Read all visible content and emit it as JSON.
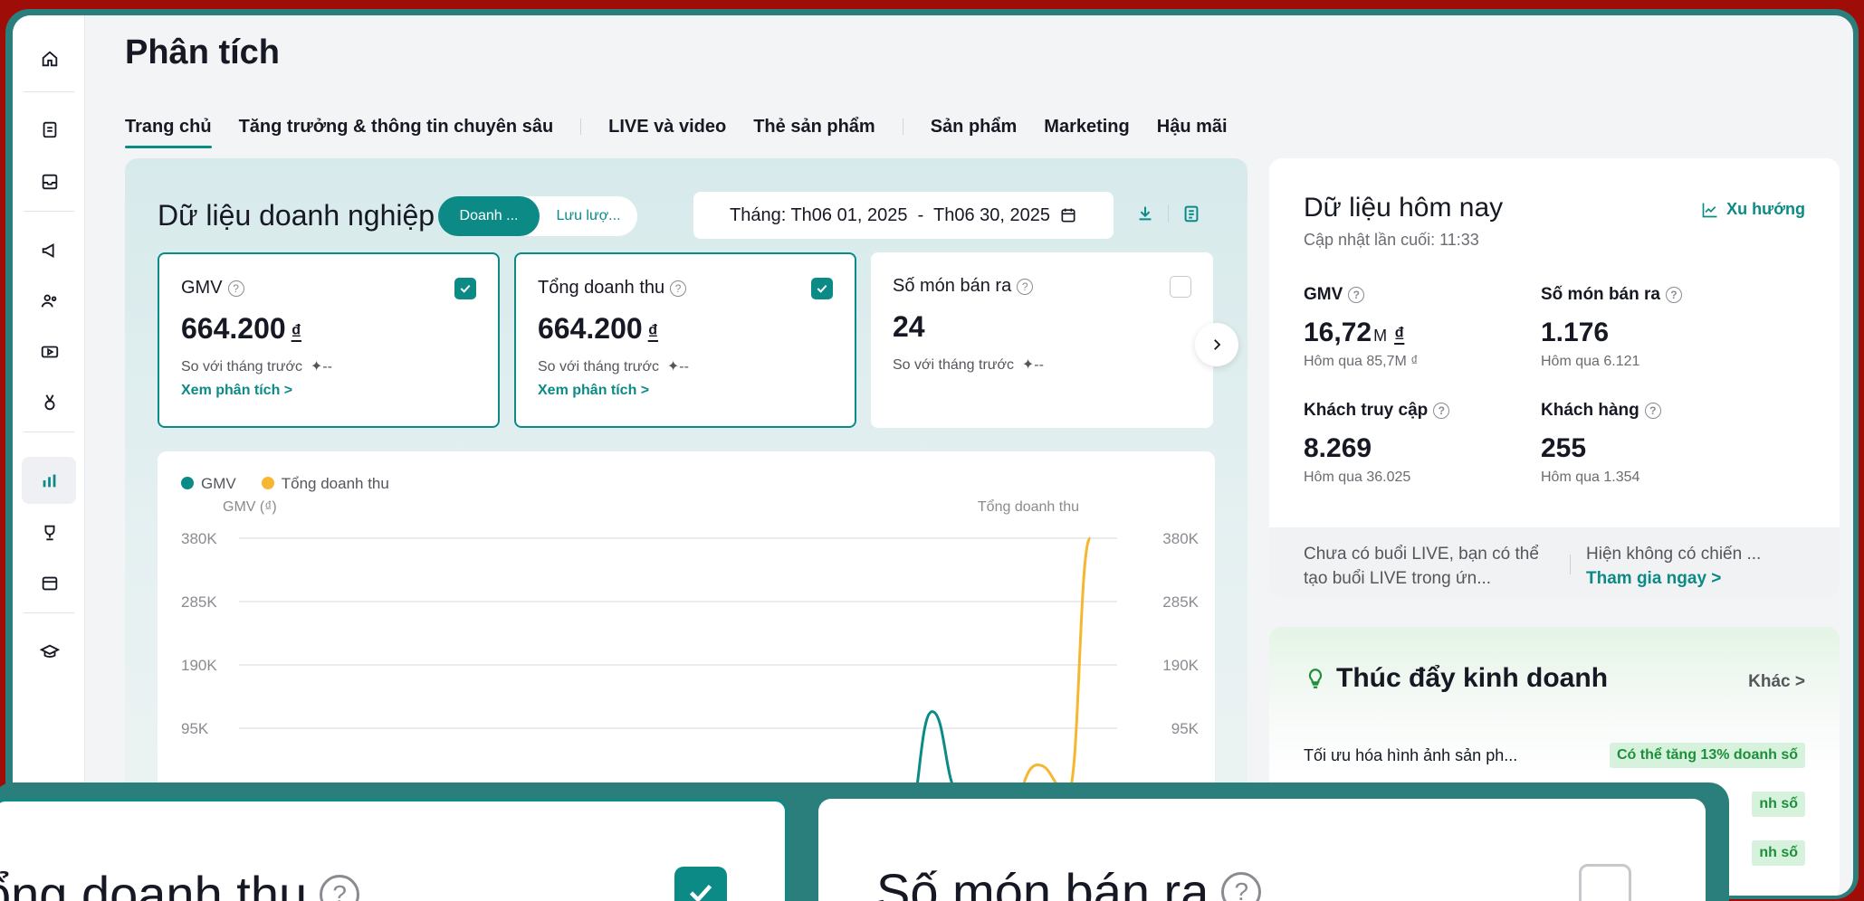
{
  "page": {
    "title": "Phân tích"
  },
  "tabs": [
    {
      "label": "Trang chủ"
    },
    {
      "label": "Tăng trưởng & thông tin chuyên sâu"
    },
    {
      "label": "LIVE và video"
    },
    {
      "label": "Thẻ sản phẩm"
    },
    {
      "label": "Sản phẩm"
    },
    {
      "label": "Marketing"
    },
    {
      "label": "Hậu mãi"
    }
  ],
  "business": {
    "title": "Dữ liệu doanh nghiệp",
    "toggle": {
      "active": "Doanh ...",
      "inactive": "Lưu lượ..."
    },
    "date_range": "Tháng: Th06 01, 2025  -  Th06 30, 2025",
    "metrics": [
      {
        "label": "GMV",
        "value": "664.200",
        "unit": "₫",
        "compare": "So với tháng trước  ✦--",
        "link": "Xem phân tích >",
        "checked": true
      },
      {
        "label": "Tổng doanh thu",
        "value": "664.200",
        "unit": "₫",
        "compare": "So với tháng trước  ✦--",
        "link": "Xem phân tích >",
        "checked": true
      },
      {
        "label": "Số món bán ra",
        "value": "24",
        "unit": "",
        "compare": "So với tháng trước  ✦--",
        "link": "",
        "checked": false
      }
    ]
  },
  "chart": {
    "legend": [
      "GMV",
      "Tổng doanh thu"
    ],
    "y_left_title": "GMV (₫)",
    "y_right_title": "Tổng doanh thu",
    "ticks": [
      "380K",
      "285K",
      "190K",
      "95K"
    ]
  },
  "chart_data": {
    "type": "line",
    "ylabel": "GMV (₫)",
    "y2label": "Tổng doanh thu",
    "ylim": [
      0,
      380000
    ],
    "yticks": [
      95000,
      190000,
      285000,
      380000
    ],
    "series": [
      {
        "name": "GMV",
        "color": "#0b8a86",
        "points": [
          [
            0.745,
            0
          ],
          [
            0.775,
            120000
          ],
          [
            0.805,
            0
          ]
        ]
      },
      {
        "name": "Tổng doanh thu",
        "color": "#f5b731",
        "points": [
          [
            0.855,
            0
          ],
          [
            0.895,
            40000
          ],
          [
            0.93,
            0
          ],
          [
            0.955,
            380000
          ]
        ]
      }
    ]
  },
  "today": {
    "title": "Dữ liệu hôm nay",
    "updated": "Cập nhật lần cuối: 11:33",
    "trend": "Xu hướng",
    "cells": [
      {
        "label": "GMV",
        "value": "16,72",
        "suffix": "M",
        "unit": "₫",
        "prev": "Hôm qua 85,7M ₫"
      },
      {
        "label": "Số món bán ra",
        "value": "1.176",
        "suffix": "",
        "unit": "",
        "prev": "Hôm qua 6.121"
      },
      {
        "label": "Khách truy cập",
        "value": "8.269",
        "suffix": "",
        "unit": "",
        "prev": "Hôm qua 36.025"
      },
      {
        "label": "Khách hàng",
        "value": "255",
        "suffix": "",
        "unit": "",
        "prev": "Hôm qua 1.354"
      }
    ],
    "live_info": "Chưa có buổi LIVE, bạn có thể tạo buổi LIVE trong ứn...",
    "campaign_info": "Hiện không có chiến ...",
    "campaign_link": "Tham gia ngay >"
  },
  "boost": {
    "title": "Thúc đẩy kinh doanh",
    "more": "Khác >",
    "rows": [
      {
        "text": "Tối ưu hóa hình ảnh sản ph...",
        "tag": "Có thể tăng 13% doanh số"
      },
      {
        "text": "",
        "tag": "nh số"
      },
      {
        "text": "",
        "tag": "nh số"
      }
    ]
  },
  "zoom": {
    "label1": "ổng doanh thu",
    "label2": "Số món bán ra"
  },
  "colors": {
    "accent": "#0b8a86",
    "gmv": "#0b8a86",
    "revenue": "#f5b731",
    "outer": "#9e0d08",
    "frame": "#2a7f7d"
  }
}
